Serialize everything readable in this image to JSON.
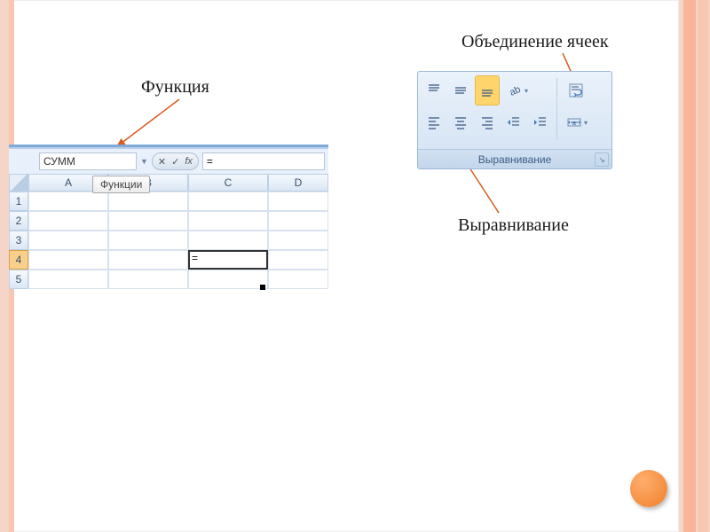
{
  "labels": {
    "function": "Функция",
    "merge": "Объединение ячеек",
    "alignment": "Выравнивание"
  },
  "excel": {
    "function_name": "СУММ",
    "formula_input": "=",
    "functions_tooltip": "Функции",
    "columns": [
      "A",
      "B",
      "C",
      "D"
    ],
    "rows": [
      "1",
      "2",
      "3",
      "4",
      "5"
    ],
    "active_row": "4",
    "active_cell_value": "="
  },
  "ribbon": {
    "group_title": "Выравнивание"
  }
}
